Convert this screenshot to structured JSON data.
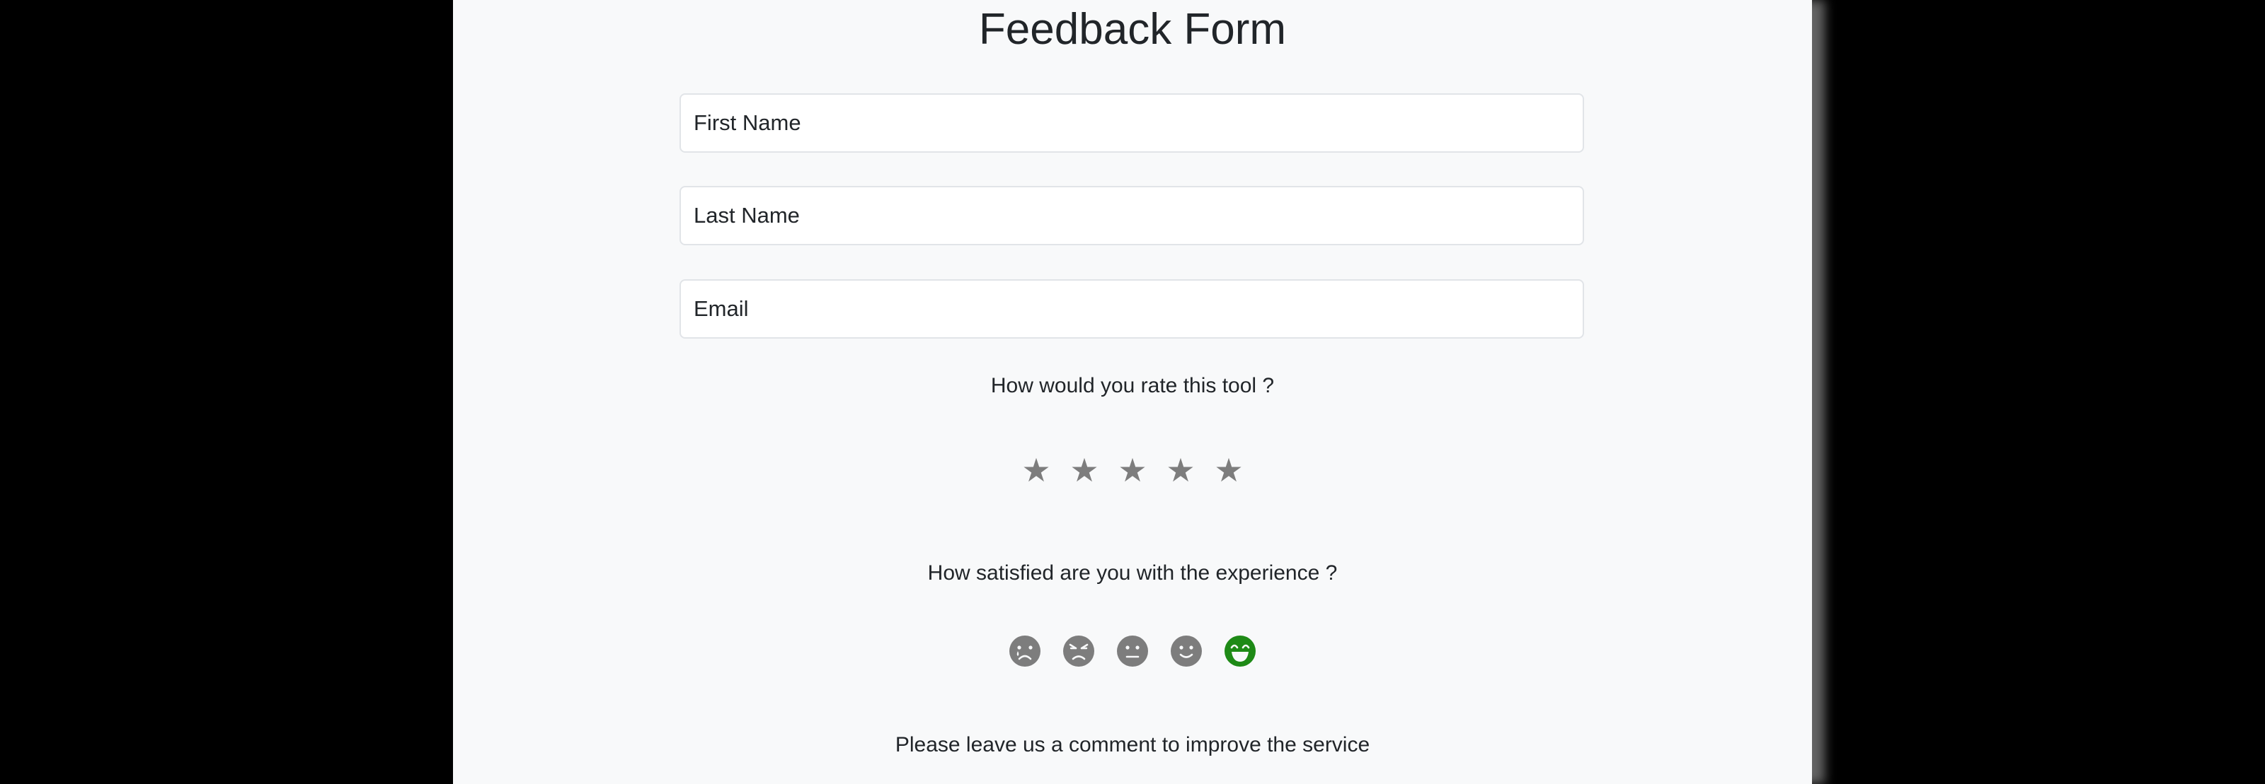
{
  "form": {
    "title": "Feedback Form",
    "first_name_placeholder": "First Name",
    "last_name_placeholder": "Last Name",
    "email_placeholder": "Email"
  },
  "rating": {
    "question": "How would you rate this tool ?",
    "stars": 5,
    "selected": 0,
    "star_glyph": "★",
    "color": "#7d7d7d"
  },
  "satisfaction": {
    "question": "How satisfied are you with the experience ?",
    "options": [
      "crying-face-icon",
      "angry-face-icon",
      "neutral-face-icon",
      "smiling-face-icon",
      "grinning-face-icon"
    ],
    "selected_index": 4,
    "inactive_color": "#7d7d7d",
    "active_color": "#1e8a16"
  },
  "comment": {
    "question": "Please leave us a comment to improve the service"
  }
}
